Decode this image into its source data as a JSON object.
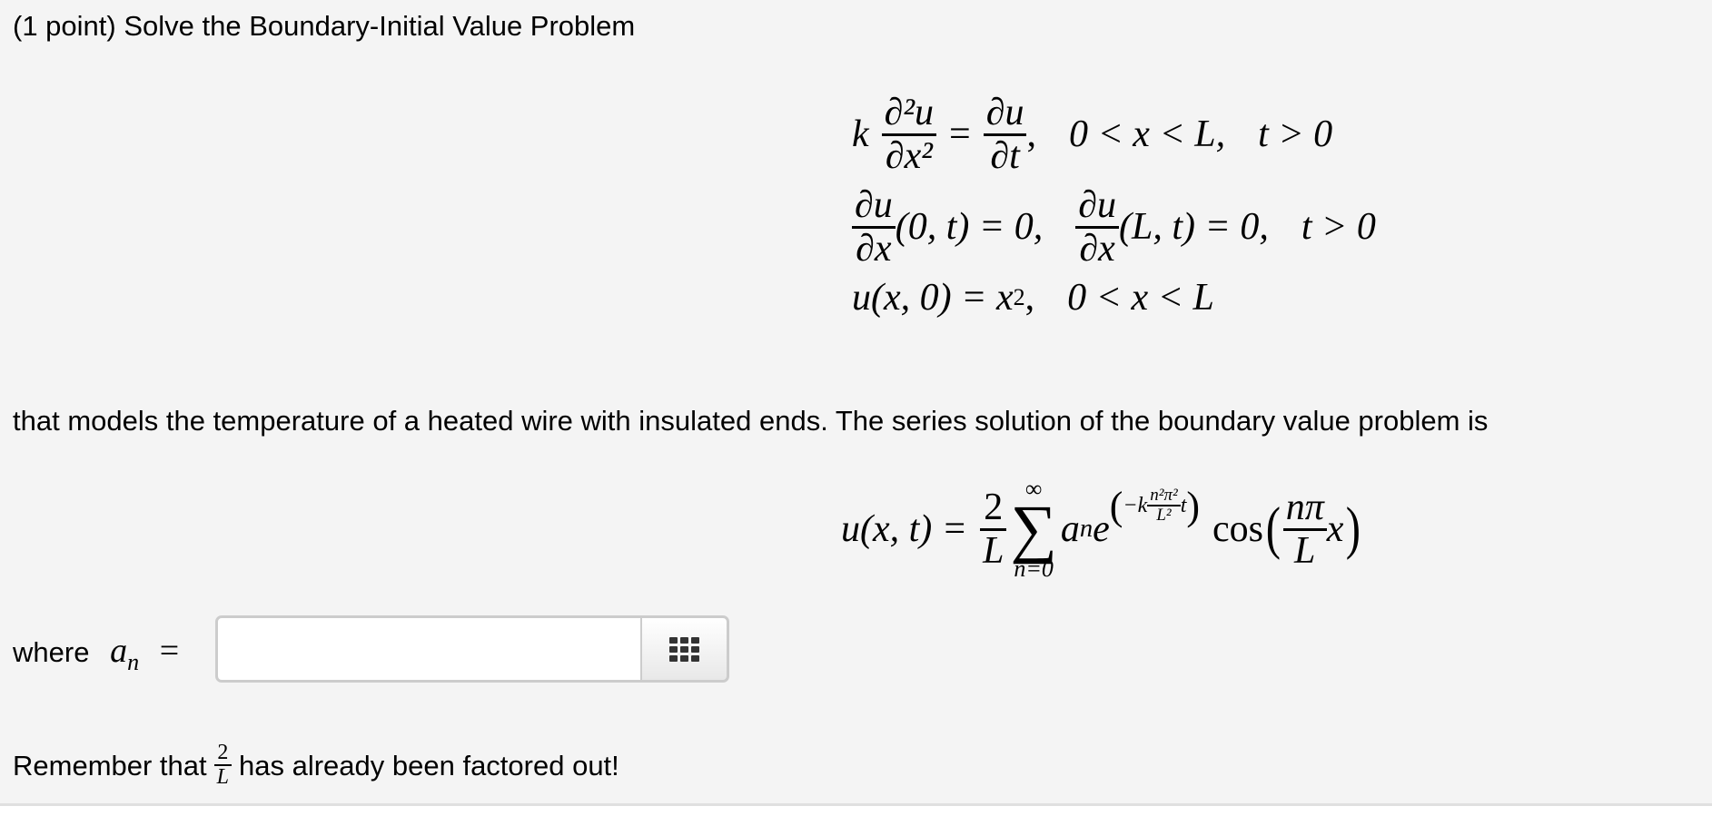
{
  "problem": {
    "title": "(1 point) Solve the Boundary-Initial Value Problem",
    "description": "that models the temperature of a heated wire with insulated ends. The series solution of the boundary value problem is",
    "answer_prefix": "where",
    "reminder_before": "Remember that",
    "reminder_after": "has already been factored out!"
  },
  "equations": {
    "pde": {
      "coef": "k",
      "lhs_num": "∂²u",
      "lhs_den": "∂x²",
      "rhs_num": "∂u",
      "rhs_den": "∂t",
      "domain": "0 < x < L,",
      "time": "t > 0"
    },
    "bc": {
      "num": "∂u",
      "den": "∂x",
      "left_arg": "(0, t) = 0,",
      "right_arg": "(L, t) = 0,",
      "time": "t > 0"
    },
    "ic": {
      "lhs": "u(x, 0) = x",
      "exp": "2",
      "comma": ",",
      "domain": "0 < x < L"
    },
    "series": {
      "lhs": "u(x, t) =",
      "coef_num": "2",
      "coef_den": "L",
      "sum_upper": "∞",
      "sum_lower": "n=0",
      "term": "a",
      "term_sub": "n",
      "base": "e",
      "exp_prefix": "−k",
      "exp_num": "n²π²",
      "exp_den": "L²",
      "exp_suffix": "t",
      "func": "cos",
      "arg_num": "nπ",
      "arg_den": "L",
      "arg_var": "x"
    },
    "answer_label": {
      "var": "a",
      "sub": "n",
      "eq": "="
    },
    "reminder_frac": {
      "num": "2",
      "den": "L"
    }
  },
  "answer_input": {
    "value": "",
    "placeholder": ""
  },
  "editor_button": {
    "icon": "grid-icon"
  }
}
